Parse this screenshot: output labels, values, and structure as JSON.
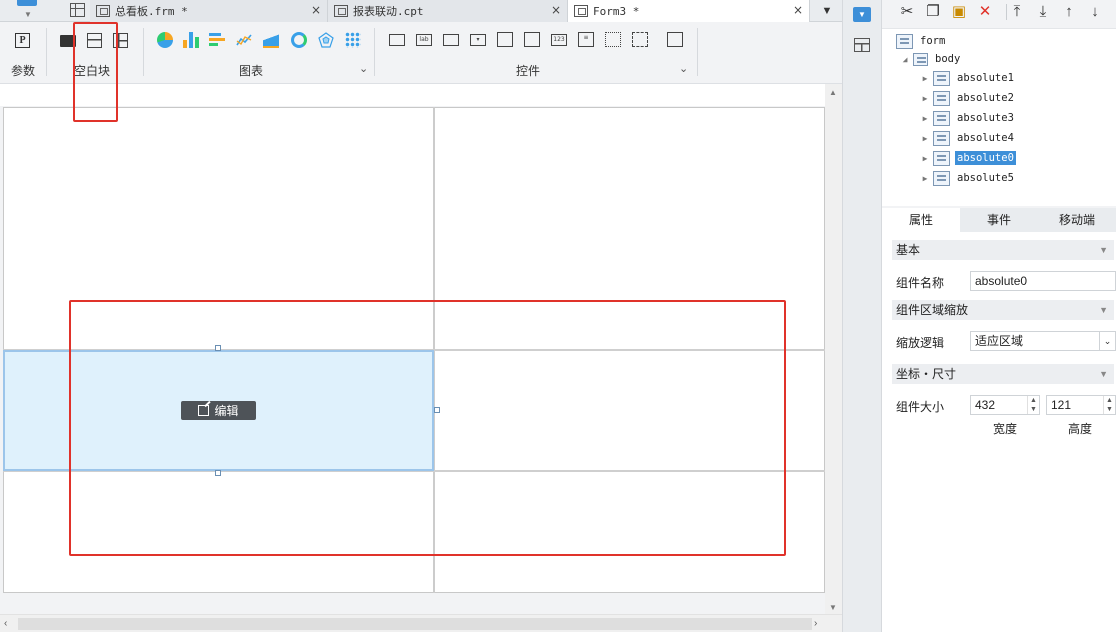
{
  "tabs": [
    {
      "label": "总看板.frm *",
      "active": false
    },
    {
      "label": "报表联动.cpt",
      "active": false
    },
    {
      "label": "Form3 *",
      "active": true
    }
  ],
  "tab_close_glyph": "×",
  "toolbar": {
    "param_label": "参数",
    "blank_block_label": "空白块",
    "chart_label": "图表",
    "control_label": "控件",
    "param_icon_text": "P",
    "control_icons": [
      {
        "name": "textbox-widget-icon",
        "text": ""
      },
      {
        "name": "label-widget-icon",
        "text": "lab"
      },
      {
        "name": "button-widget-icon",
        "text": ""
      },
      {
        "name": "combobox-widget-icon",
        "text": "▾"
      },
      {
        "name": "form-widget-icon",
        "text": ""
      },
      {
        "name": "date-widget-icon",
        "text": ""
      },
      {
        "name": "number-widget-icon",
        "text": "123"
      },
      {
        "name": "textarea-widget-icon",
        "text": "≡"
      },
      {
        "name": "radio-group-widget-icon",
        "text": ""
      },
      {
        "name": "checkbox-group-widget-icon",
        "text": ""
      },
      {
        "name": "tree-widget-icon",
        "text": ""
      }
    ]
  },
  "canvas": {
    "edit_button_label": "编辑"
  },
  "right_panel": {
    "tree": {
      "root": "form",
      "body": "body",
      "children": [
        {
          "label": "absolute1",
          "selected": false
        },
        {
          "label": "absolute2",
          "selected": false
        },
        {
          "label": "absolute3",
          "selected": false
        },
        {
          "label": "absolute4",
          "selected": false
        },
        {
          "label": "absolute0",
          "selected": true
        },
        {
          "label": "absolute5",
          "selected": false
        }
      ]
    },
    "prop_tabs": [
      "属性",
      "事件",
      "移动端"
    ],
    "sections": {
      "basic": "基本",
      "area_scale": "组件区域缩放",
      "coord_size": "坐标・尺寸"
    },
    "fields": {
      "component_name_label": "组件名称",
      "component_name_value": "absolute0",
      "scale_logic_label": "缩放逻辑",
      "scale_logic_value": "适应区域",
      "component_size_label": "组件大小",
      "width_value": "432",
      "height_value": "121",
      "width_label": "宽度",
      "height_label": "高度"
    }
  },
  "colors": {
    "accent": "#3d8fd8",
    "highlight_red": "#e0322a",
    "selected_block_fill": "#dff1fc"
  }
}
